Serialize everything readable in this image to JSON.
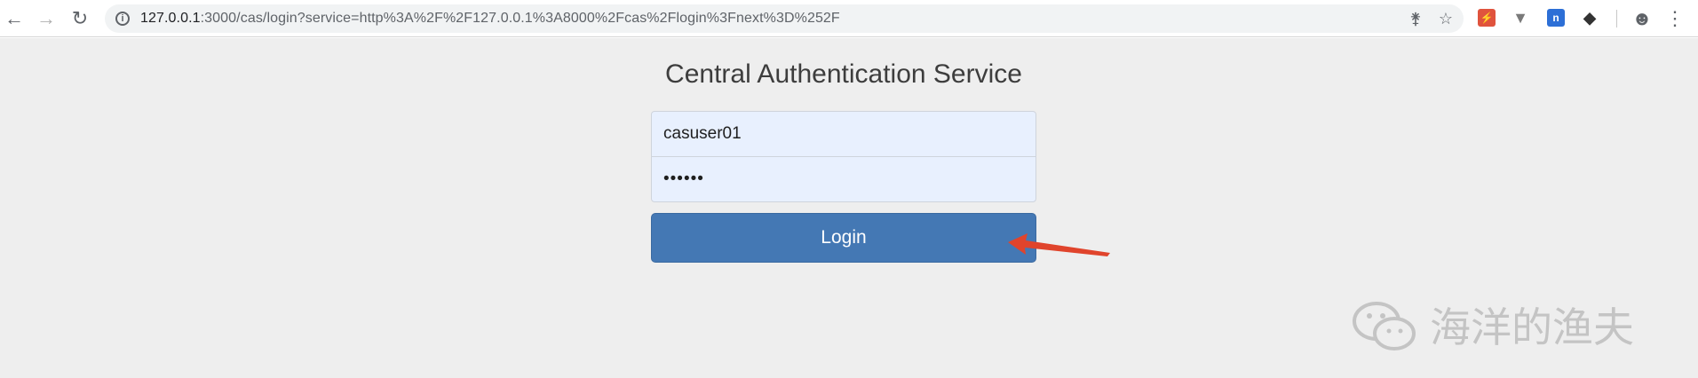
{
  "browser": {
    "url_host": "127.0.0.1",
    "url_rest": ":3000/cas/login?service=http%3A%2F%2F127.0.0.1%3A8000%2Fcas%2Flogin%3Fnext%3D%252F"
  },
  "page": {
    "title": "Central Authentication Service",
    "username_value": "casuser01",
    "password_value": "••••••",
    "login_label": "Login"
  },
  "watermark": {
    "text": "海洋的渔夫"
  },
  "colors": {
    "button": "#4478b4",
    "input_bg": "#e8f0fe",
    "page_bg": "#eeeeee",
    "arrow": "#e0442c"
  }
}
